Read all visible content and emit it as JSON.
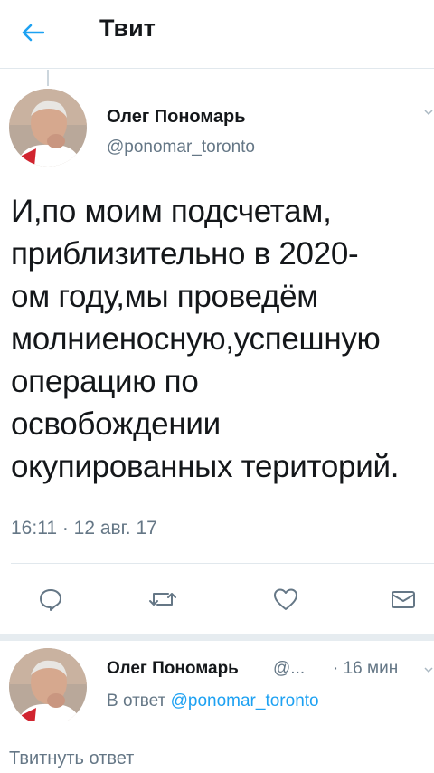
{
  "header": {
    "title": "Твит",
    "back_icon": "arrow-left-icon"
  },
  "tweet": {
    "author_name": "Олег Пономарь",
    "author_handle": "@ponomar_toronto",
    "text": "И,по моим подсчетам,\nприблизительно в 2020-\nом году,мы проведём\nмолниеносную,успешную\nоперацию по\nосвобождении\nокупированных територий.",
    "timestamp": "16:11 · 12 авг. 17"
  },
  "actions": [
    {
      "name": "reply",
      "icon": "reply-icon"
    },
    {
      "name": "retweet",
      "icon": "retweet-icon"
    },
    {
      "name": "like",
      "icon": "heart-icon"
    },
    {
      "name": "message",
      "icon": "envelope-icon"
    }
  ],
  "reply": {
    "author_name": "Олег Пономарь",
    "handle_truncated": "@...",
    "time": "· 16 мин",
    "reply_to_label": "В ответ",
    "reply_to_handle": "@ponomar_toronto"
  },
  "compose": {
    "placeholder": "Твитнуть ответ"
  },
  "colors": {
    "accent": "#1da1f2",
    "secondary_text": "#657786",
    "divider": "#e1e8ed"
  }
}
